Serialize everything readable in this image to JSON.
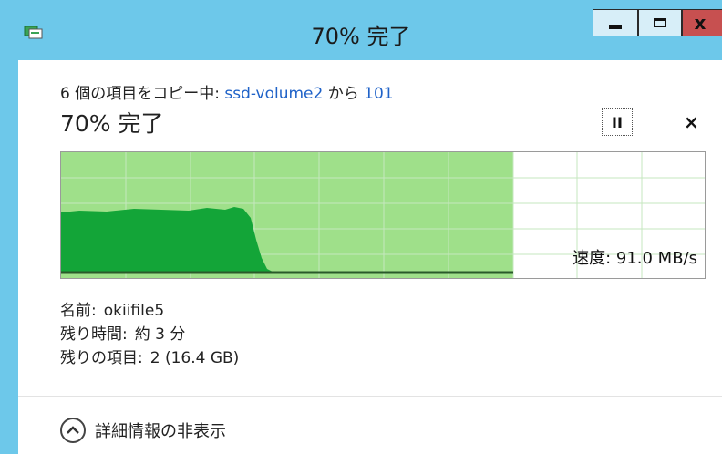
{
  "window": {
    "title": "70% 完了",
    "accent": "#6dc8ea"
  },
  "controls": {
    "minimize_glyph": "—",
    "maximize_glyph": "□",
    "close_glyph": "x"
  },
  "copy": {
    "prefix": "6 個の項目をコピー中: ",
    "source": "ssd-volume2",
    "middle": " から ",
    "destination": "101",
    "status": "70% 完了",
    "progress_fraction": 0.7,
    "pause_glyph": "II",
    "cancel_glyph": "×"
  },
  "graph": {
    "speed_text": "速度: 91.0 MB/s",
    "fill_color": "#9fe08a",
    "speed_area_color": "#13a538"
  },
  "details": {
    "name_label": "名前:",
    "name_value": "okiifile5",
    "time_label": "残り時間:",
    "time_value": "約 3 分",
    "items_label": "残りの項目:",
    "items_value": "2 (16.4 GB)"
  },
  "footer": {
    "toggle_label": "詳細情報の非表示",
    "toggle_icon": "chevron-up-icon"
  }
}
